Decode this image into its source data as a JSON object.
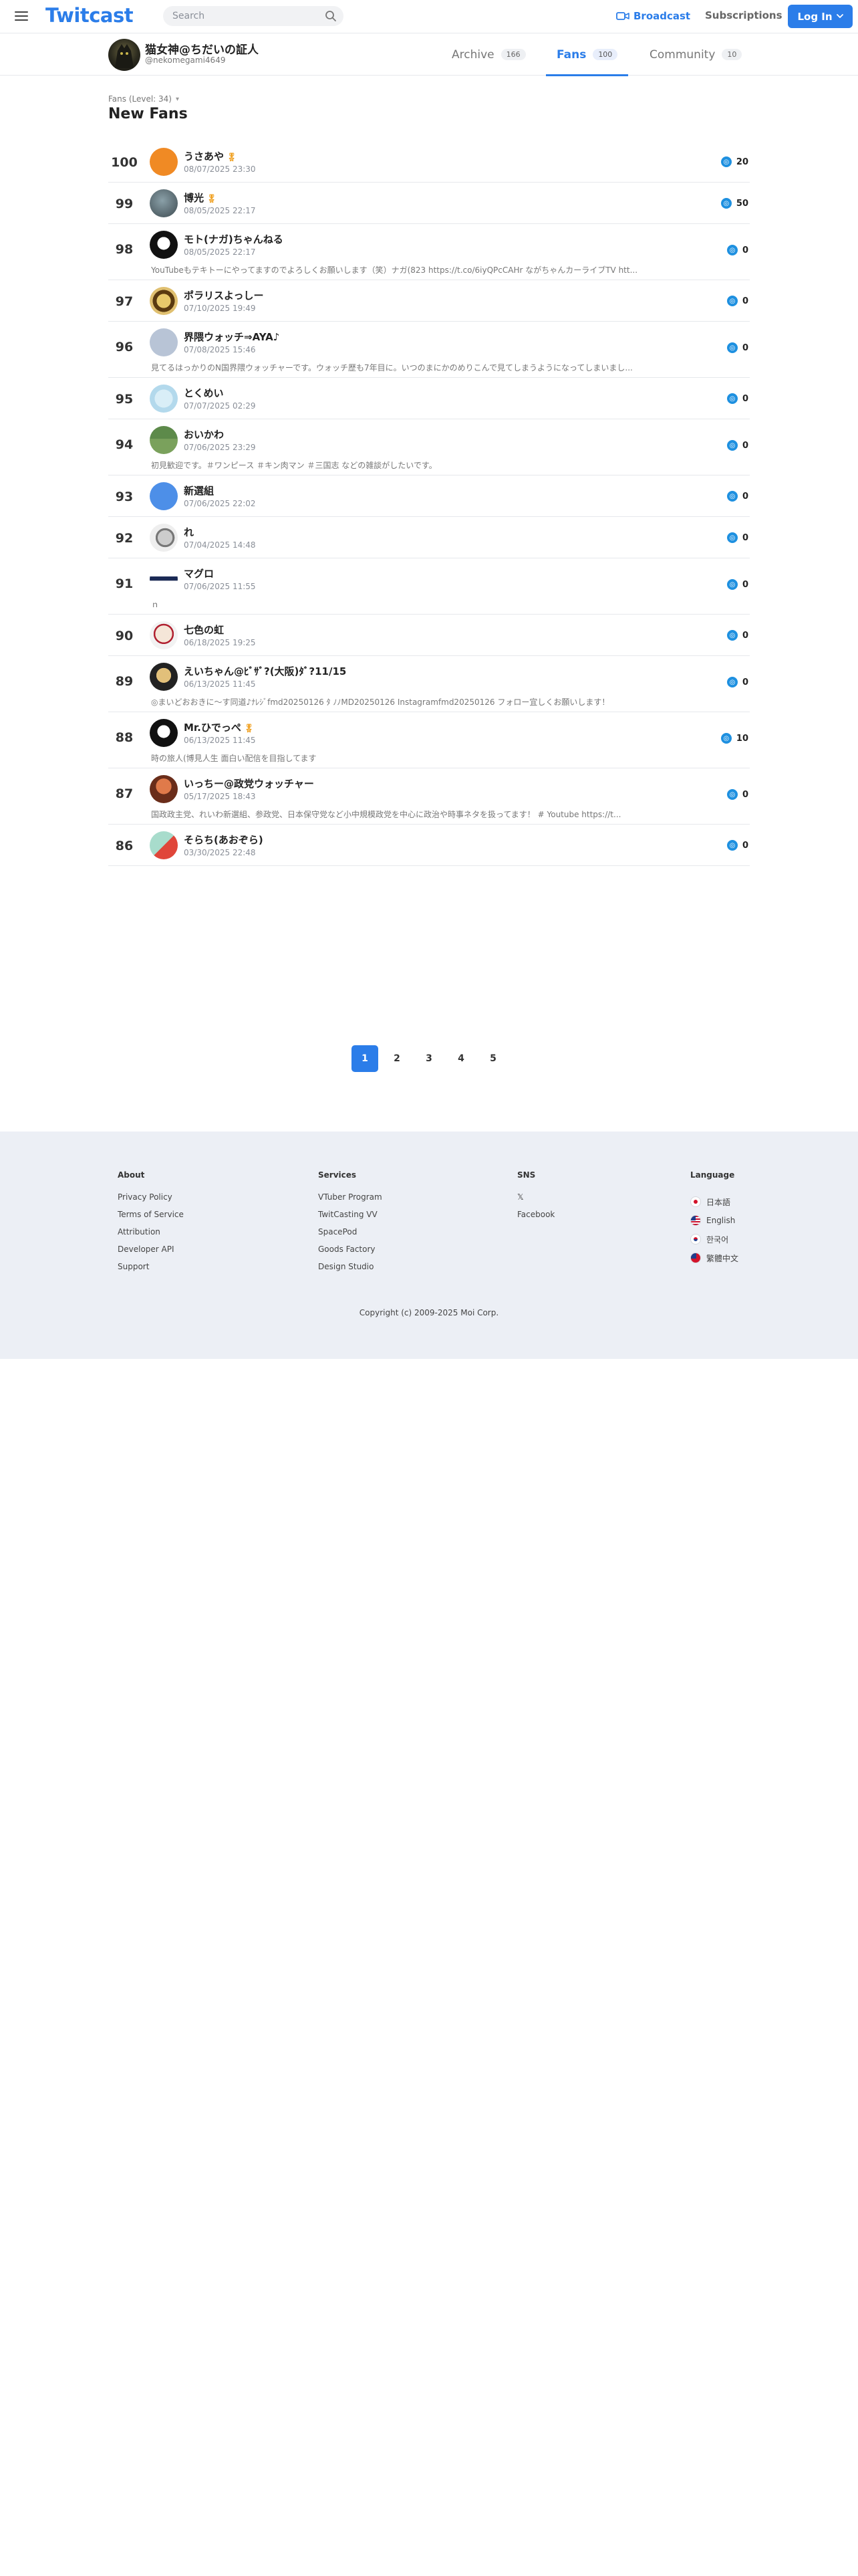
{
  "header": {
    "logo": "Twitcast",
    "search_placeholder": "Search",
    "broadcast_label": "Broadcast",
    "subscriptions_label": "Subscriptions",
    "login_label": "Log In"
  },
  "profile": {
    "name": "猫女神@ちだいの証人",
    "id": "@nekomegami4649"
  },
  "tabs": [
    {
      "label": "Archive",
      "count": "166"
    },
    {
      "label": "Fans",
      "count": "100"
    },
    {
      "label": "Community",
      "count": "10"
    }
  ],
  "section": {
    "crumb": "Fans (Level: 34)",
    "title": "New Fans"
  },
  "fans": [
    {
      "rank": "100",
      "name": "うさあや",
      "medal": true,
      "date": "08/07/2025 23:30",
      "score": "20",
      "desc": ""
    },
    {
      "rank": "99",
      "name": "博光",
      "medal": true,
      "date": "08/05/2025 22:17",
      "score": "50",
      "desc": ""
    },
    {
      "rank": "98",
      "name": "モト(ナガ)ちゃんねる",
      "medal": false,
      "date": "08/05/2025 22:17",
      "score": "0",
      "desc": "YouTubeもテキトーにやってますのでよろしくお願いします（笑）ナガ(823 https://t.co/6iyQPcCAHr ながちゃんカーライブTV htt..."
    },
    {
      "rank": "97",
      "name": "ポラリスよっしー",
      "medal": false,
      "date": "07/10/2025 19:49",
      "score": "0",
      "desc": ""
    },
    {
      "rank": "96",
      "name": "界隈ウォッチ⇒AYA♪",
      "medal": false,
      "date": "07/08/2025 15:46",
      "score": "0",
      "desc": "見てるはっかりのN国界隈ウォッチャーです。ウォッチ歴も7年目に。いつのまにかのめりこんで見てしまうようになってしまいまし..."
    },
    {
      "rank": "95",
      "name": "とくめい",
      "medal": false,
      "date": "07/07/2025 02:29",
      "score": "0",
      "desc": ""
    },
    {
      "rank": "94",
      "name": "おいかわ",
      "medal": false,
      "date": "07/06/2025 23:29",
      "score": "0",
      "desc": "初見歓迎です。＃ワンピース ＃キン肉マン ＃三国志 などの雑談がしたいです。"
    },
    {
      "rank": "93",
      "name": "新選組",
      "medal": false,
      "date": "07/06/2025 22:02",
      "score": "0",
      "desc": ""
    },
    {
      "rank": "92",
      "name": "れ",
      "medal": false,
      "date": "07/04/2025 14:48",
      "score": "0",
      "desc": ""
    },
    {
      "rank": "91",
      "name": "マグロ",
      "medal": false,
      "date": "07/06/2025 11:55",
      "score": "0",
      "desc": "ｎ"
    },
    {
      "rank": "90",
      "name": "七色の虹",
      "medal": false,
      "date": "06/18/2025 19:25",
      "score": "0",
      "desc": ""
    },
    {
      "rank": "89",
      "name": "えいちゃん@ﾋﾞｻﾞ?(大阪)ﾀﾞ?11/15",
      "medal": false,
      "date": "06/13/2025 11:45",
      "score": "0",
      "desc": "◎まいどおおきに〜す同道♪ﾅﾚｼﾞfmd20250126 ﾀ ﾉﾉMD20250126 Instagramfmd20250126 フォロー宜しくお願いします！"
    },
    {
      "rank": "88",
      "name": "Mr.ひでっぺ",
      "medal": true,
      "date": "06/13/2025 11:45",
      "score": "10",
      "desc": "時の旅人(博見人生 面白い配信を目指してます"
    },
    {
      "rank": "87",
      "name": "いっちー@政党ウォッチャー",
      "medal": false,
      "date": "05/17/2025 18:43",
      "score": "0",
      "desc": "国政政主党、れいわ新選組、参政党、日本保守党など小中規模政党を中心に政治や時事ネタを扱ってます！ # Youtube https://t..."
    },
    {
      "rank": "86",
      "name": "そらち(あおぞら)",
      "medal": false,
      "date": "03/30/2025 22:48",
      "score": "0",
      "desc": ""
    }
  ],
  "pagination": [
    "1",
    "2",
    "3",
    "4",
    "5"
  ],
  "footer": {
    "about": {
      "title": "About",
      "links": [
        "Privacy Policy",
        "Terms of Service",
        "Attribution",
        "Developer API",
        "Support"
      ]
    },
    "services": {
      "title": "Services",
      "links": [
        "VTuber Program",
        "TwitCasting VV",
        "SpacePod",
        "Goods Factory",
        "Design Studio"
      ]
    },
    "sns": {
      "title": "SNS",
      "links": [
        "𝕏",
        "Facebook"
      ]
    },
    "language": {
      "title": "Language",
      "links": [
        "日本語",
        "English",
        "한국어",
        "繁體中文"
      ]
    },
    "copyright": "Copyright (c) 2009-2025 Moi Corp."
  },
  "colors": {
    "accent": "#2b7de9",
    "coin": "#1e90e0",
    "footer_bg": "#eceff5"
  }
}
